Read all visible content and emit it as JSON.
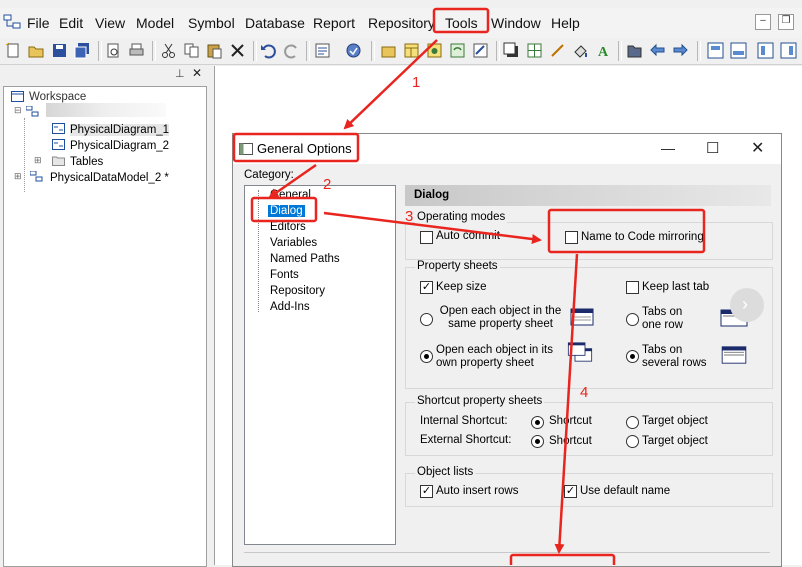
{
  "menu": {
    "items": [
      "File",
      "Edit",
      "View",
      "Model",
      "Symbol",
      "Database",
      "Report",
      "Repository",
      "Tools",
      "Window",
      "Help"
    ]
  },
  "browser": {
    "workspace_label": "Workspace",
    "items": [
      {
        "label": "PhysicalDiagram_1"
      },
      {
        "label": "PhysicalDiagram_2"
      },
      {
        "label": "Tables"
      },
      {
        "label": "PhysicalDataModel_2 *"
      }
    ]
  },
  "dialog": {
    "title": "General Options",
    "category_label": "Category:",
    "categories": [
      "General",
      "Dialog",
      "Editors",
      "Variables",
      "Named Paths",
      "Fonts",
      "Repository",
      "Add-Ins"
    ],
    "selected_category": "Dialog",
    "panel_title": "Dialog",
    "operating_modes": {
      "title": "Operating modes",
      "auto_commit": "Auto commit",
      "name_to_code": "Name to Code mirroring"
    },
    "property_sheets": {
      "title": "Property sheets",
      "keep_size": "Keep size",
      "keep_last_tab": "Keep last tab",
      "open_same": "Open each object in the same property sheet",
      "open_own": "Open each object in its own property sheet",
      "tabs_one_row": "Tabs on one row",
      "tabs_several_rows": "Tabs on several rows"
    },
    "shortcut_sheets": {
      "title": "Shortcut property sheets",
      "internal": "Internal Shortcut:",
      "external": "External Shortcut:",
      "shortcut": "Shortcut",
      "target_object": "Target object"
    },
    "object_lists": {
      "title": "Object lists",
      "auto_insert_rows": "Auto insert rows",
      "use_default_name": "Use default name"
    }
  },
  "annotations": {
    "step1": "1",
    "step2": "2",
    "step3": "3",
    "step4": "4",
    "color": "#e8251e"
  }
}
